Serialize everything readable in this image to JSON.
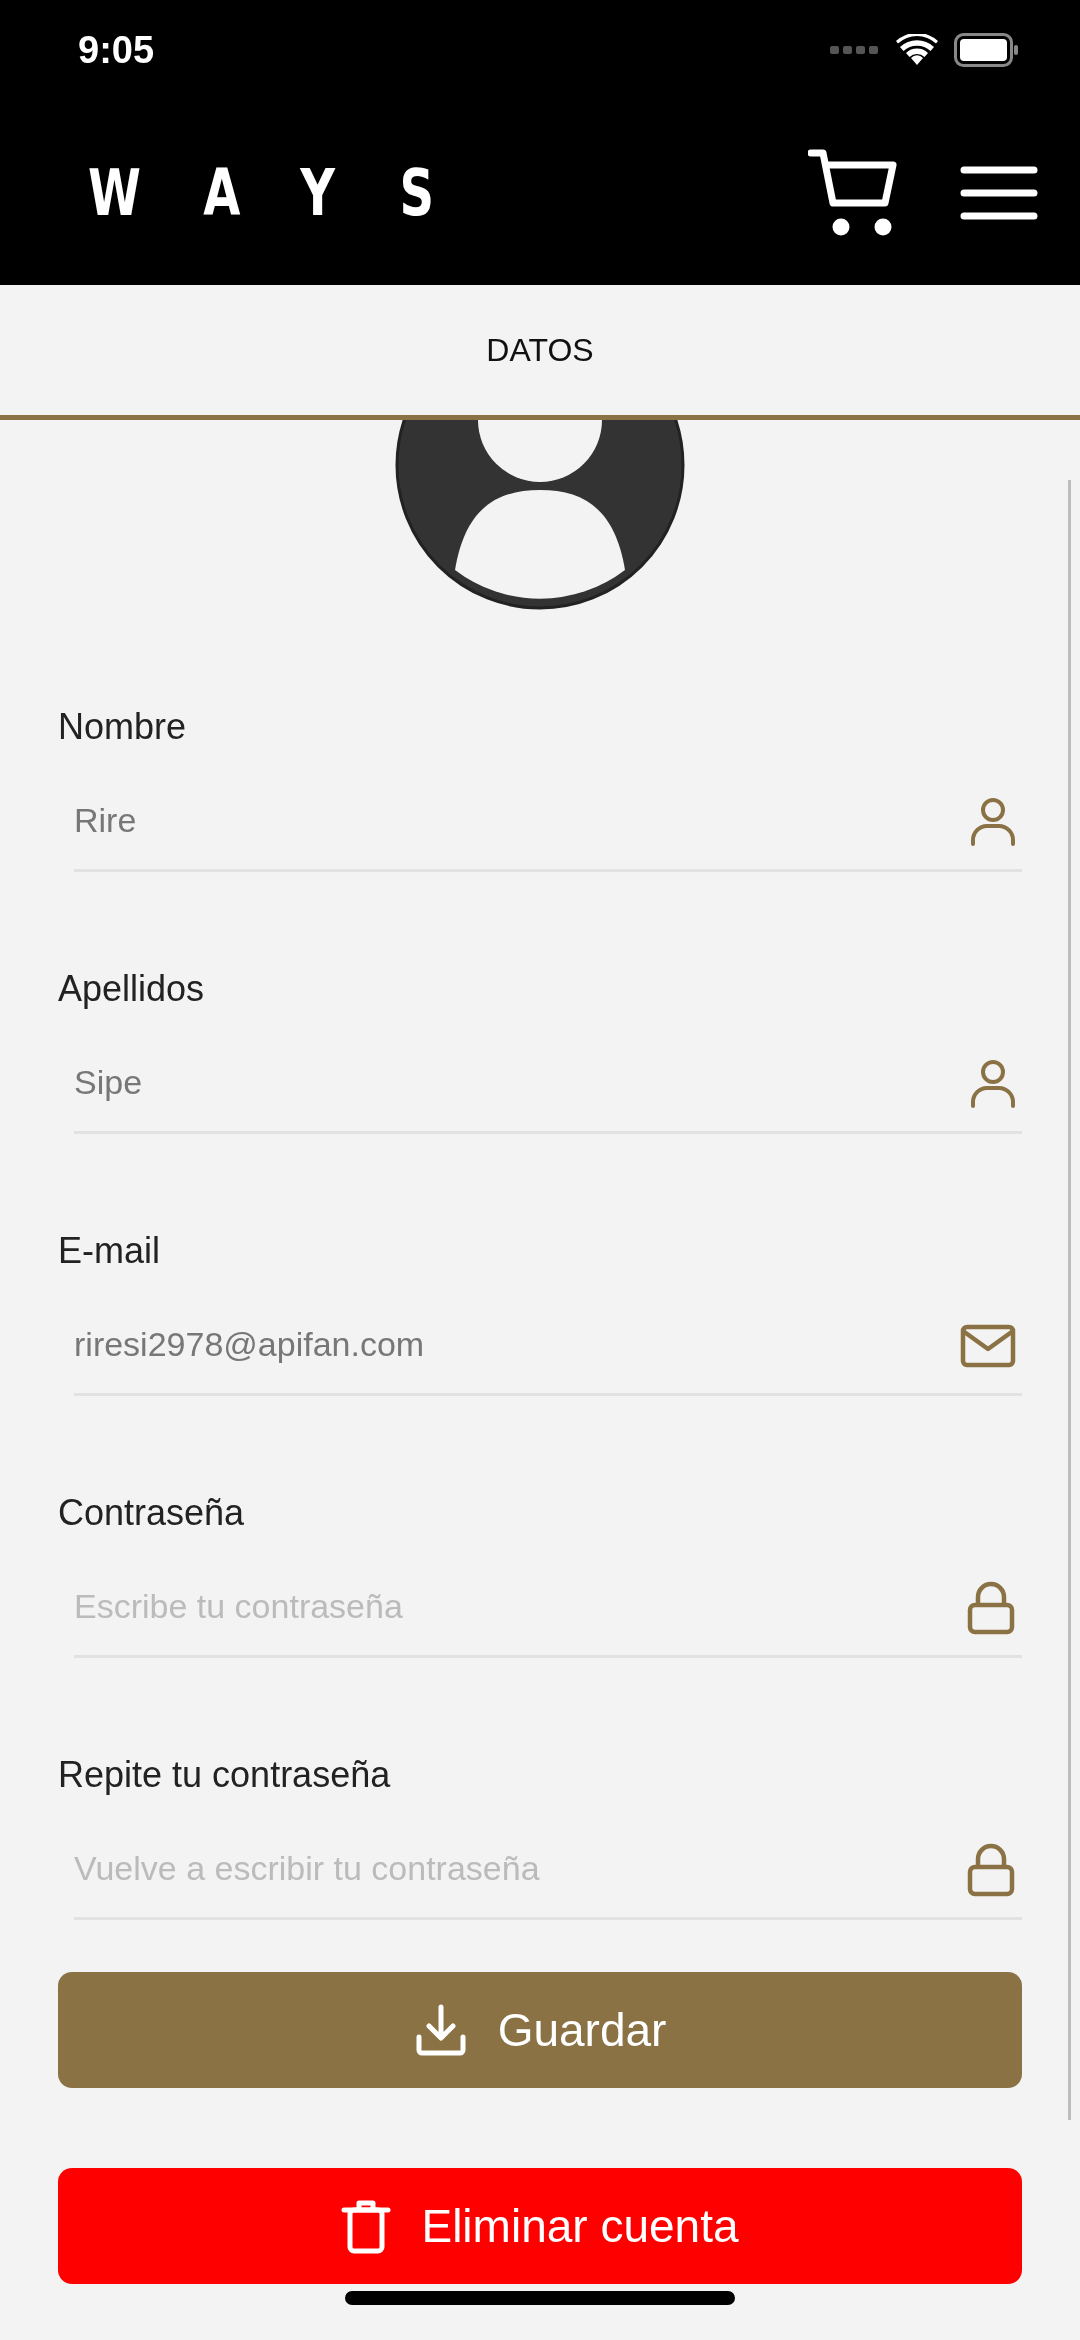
{
  "status_bar": {
    "time": "9:05"
  },
  "header": {
    "logo": "WAYS"
  },
  "tabs": [
    {
      "label": "DATOS",
      "selected": true
    }
  ],
  "fields": [
    {
      "kind": "name",
      "label": "Nombre",
      "value": "Rire"
    },
    {
      "kind": "name",
      "label": "Apellidos",
      "value": "Sipe"
    },
    {
      "kind": "email",
      "label": "E-mail",
      "value": "riresi2978@apifan.com"
    },
    {
      "kind": "password",
      "label": "Contraseña",
      "placeholder": "Escribe tu contraseña"
    },
    {
      "kind": "password",
      "label": "Repite tu contraseña",
      "placeholder": "Vuelve a escribir tu contraseña"
    }
  ],
  "buttons": [
    {
      "kind": "save",
      "label": "Guardar"
    },
    {
      "kind": "delete",
      "label": "Eliminar cuenta"
    }
  ]
}
